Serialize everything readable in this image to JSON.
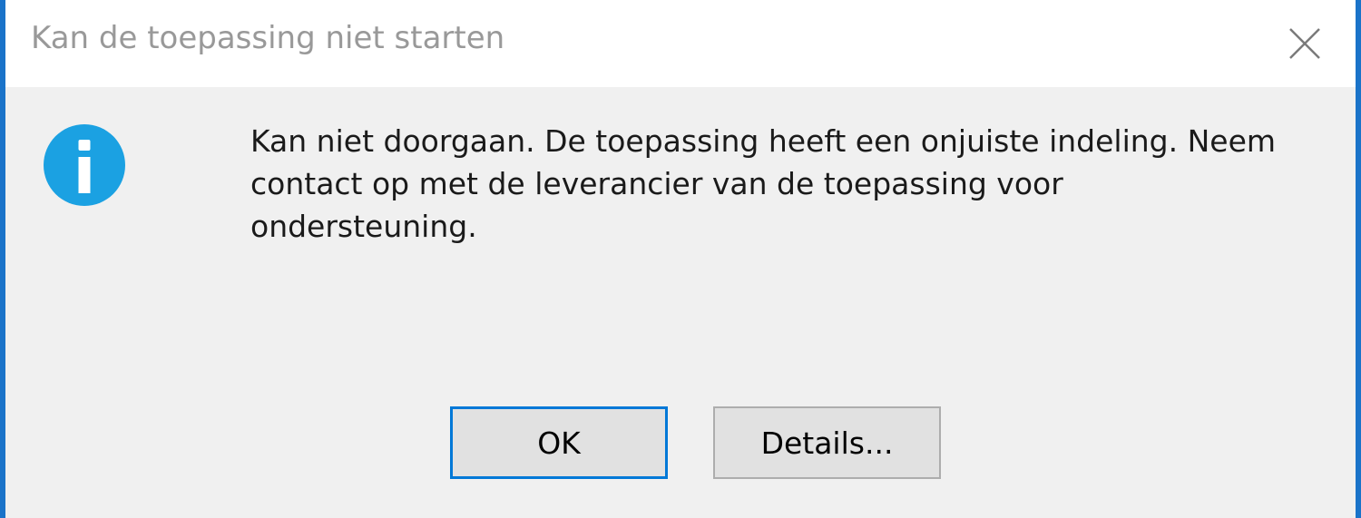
{
  "window": {
    "title": "Kan de toepassing niet starten"
  },
  "dialog": {
    "icon": "info-icon",
    "message_lines": [
      "Kan niet doorgaan. De toepassing heeft een onjuiste indeling. Neem",
      "contact op met de leverancier van de toepassing voor",
      "ondersteuning."
    ]
  },
  "buttons": {
    "ok_label": "OK",
    "details_label": "Details..."
  },
  "colors": {
    "accent": "#0078d7",
    "window_border": "#1a73c9",
    "info_icon": "#1ba1e2",
    "background": "#f0f0f0"
  }
}
